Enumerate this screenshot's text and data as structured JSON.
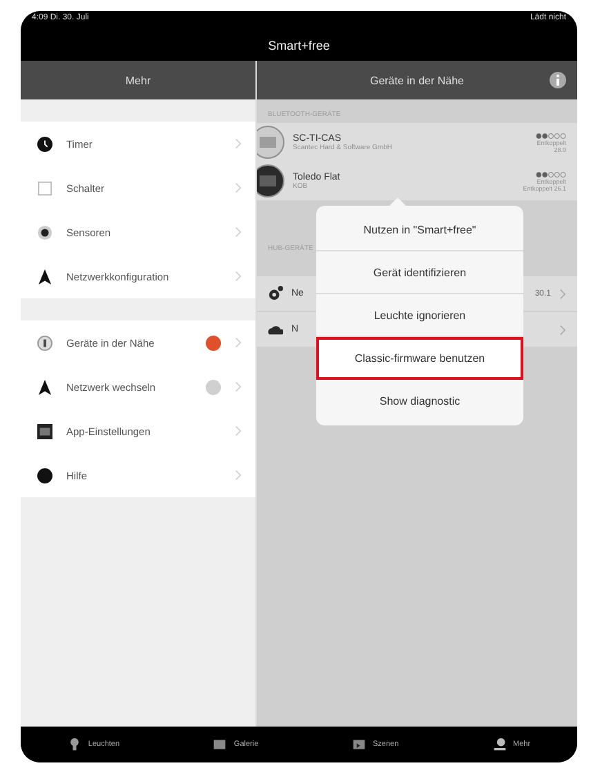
{
  "status_bar": {
    "time": "4:09 Di. 30. Juli",
    "battery": "Lädt nicht"
  },
  "nav_title": "Smart+free",
  "left_header": "Mehr",
  "right_header": "Geräte in der Nähe",
  "menu_groups": [
    [
      {
        "label": "Timer"
      },
      {
        "label": "Schalter"
      },
      {
        "label": "Sensoren"
      },
      {
        "label": "Netzwerkkonfiguration"
      }
    ],
    [
      {
        "label": "Geräte in der Nähe",
        "color": "#e0502a"
      },
      {
        "label": "Netzwerk wechseln",
        "color": "#d0d0d0"
      },
      {
        "label": "App-Einstellungen"
      },
      {
        "label": "Hilfe"
      }
    ]
  ],
  "bluetooth": {
    "heading": "BLUETOOTH-GERÄTE",
    "devices": [
      {
        "name": "SC-TI-CAS",
        "vendor": "Scantec Hard & Software GmbH",
        "status": "Entkoppelt",
        "detail": "28.0"
      },
      {
        "name": "Toledo Flat",
        "vendor": "KOB",
        "status": "Entkoppelt",
        "detail": "Entkoppelt 26.1"
      }
    ]
  },
  "hub": {
    "heading": "HUB-GERÄTE",
    "rows": [
      {
        "label": "Ne",
        "value": "30.1"
      },
      {
        "label": "N",
        "value": ""
      }
    ]
  },
  "popover": [
    {
      "label": "Nutzen in \"Smart+free\"",
      "selected": false
    },
    {
      "label": "Gerät identifizieren",
      "selected": false
    },
    {
      "label": "Leuchte ignorieren",
      "selected": false
    },
    {
      "label": "Classic-firmware benutzen",
      "selected": true
    },
    {
      "label": "Show diagnostic",
      "selected": false
    }
  ],
  "tabs": [
    {
      "label": "Leuchten"
    },
    {
      "label": "Galerie"
    },
    {
      "label": "Szenen"
    },
    {
      "label": "Mehr"
    }
  ]
}
